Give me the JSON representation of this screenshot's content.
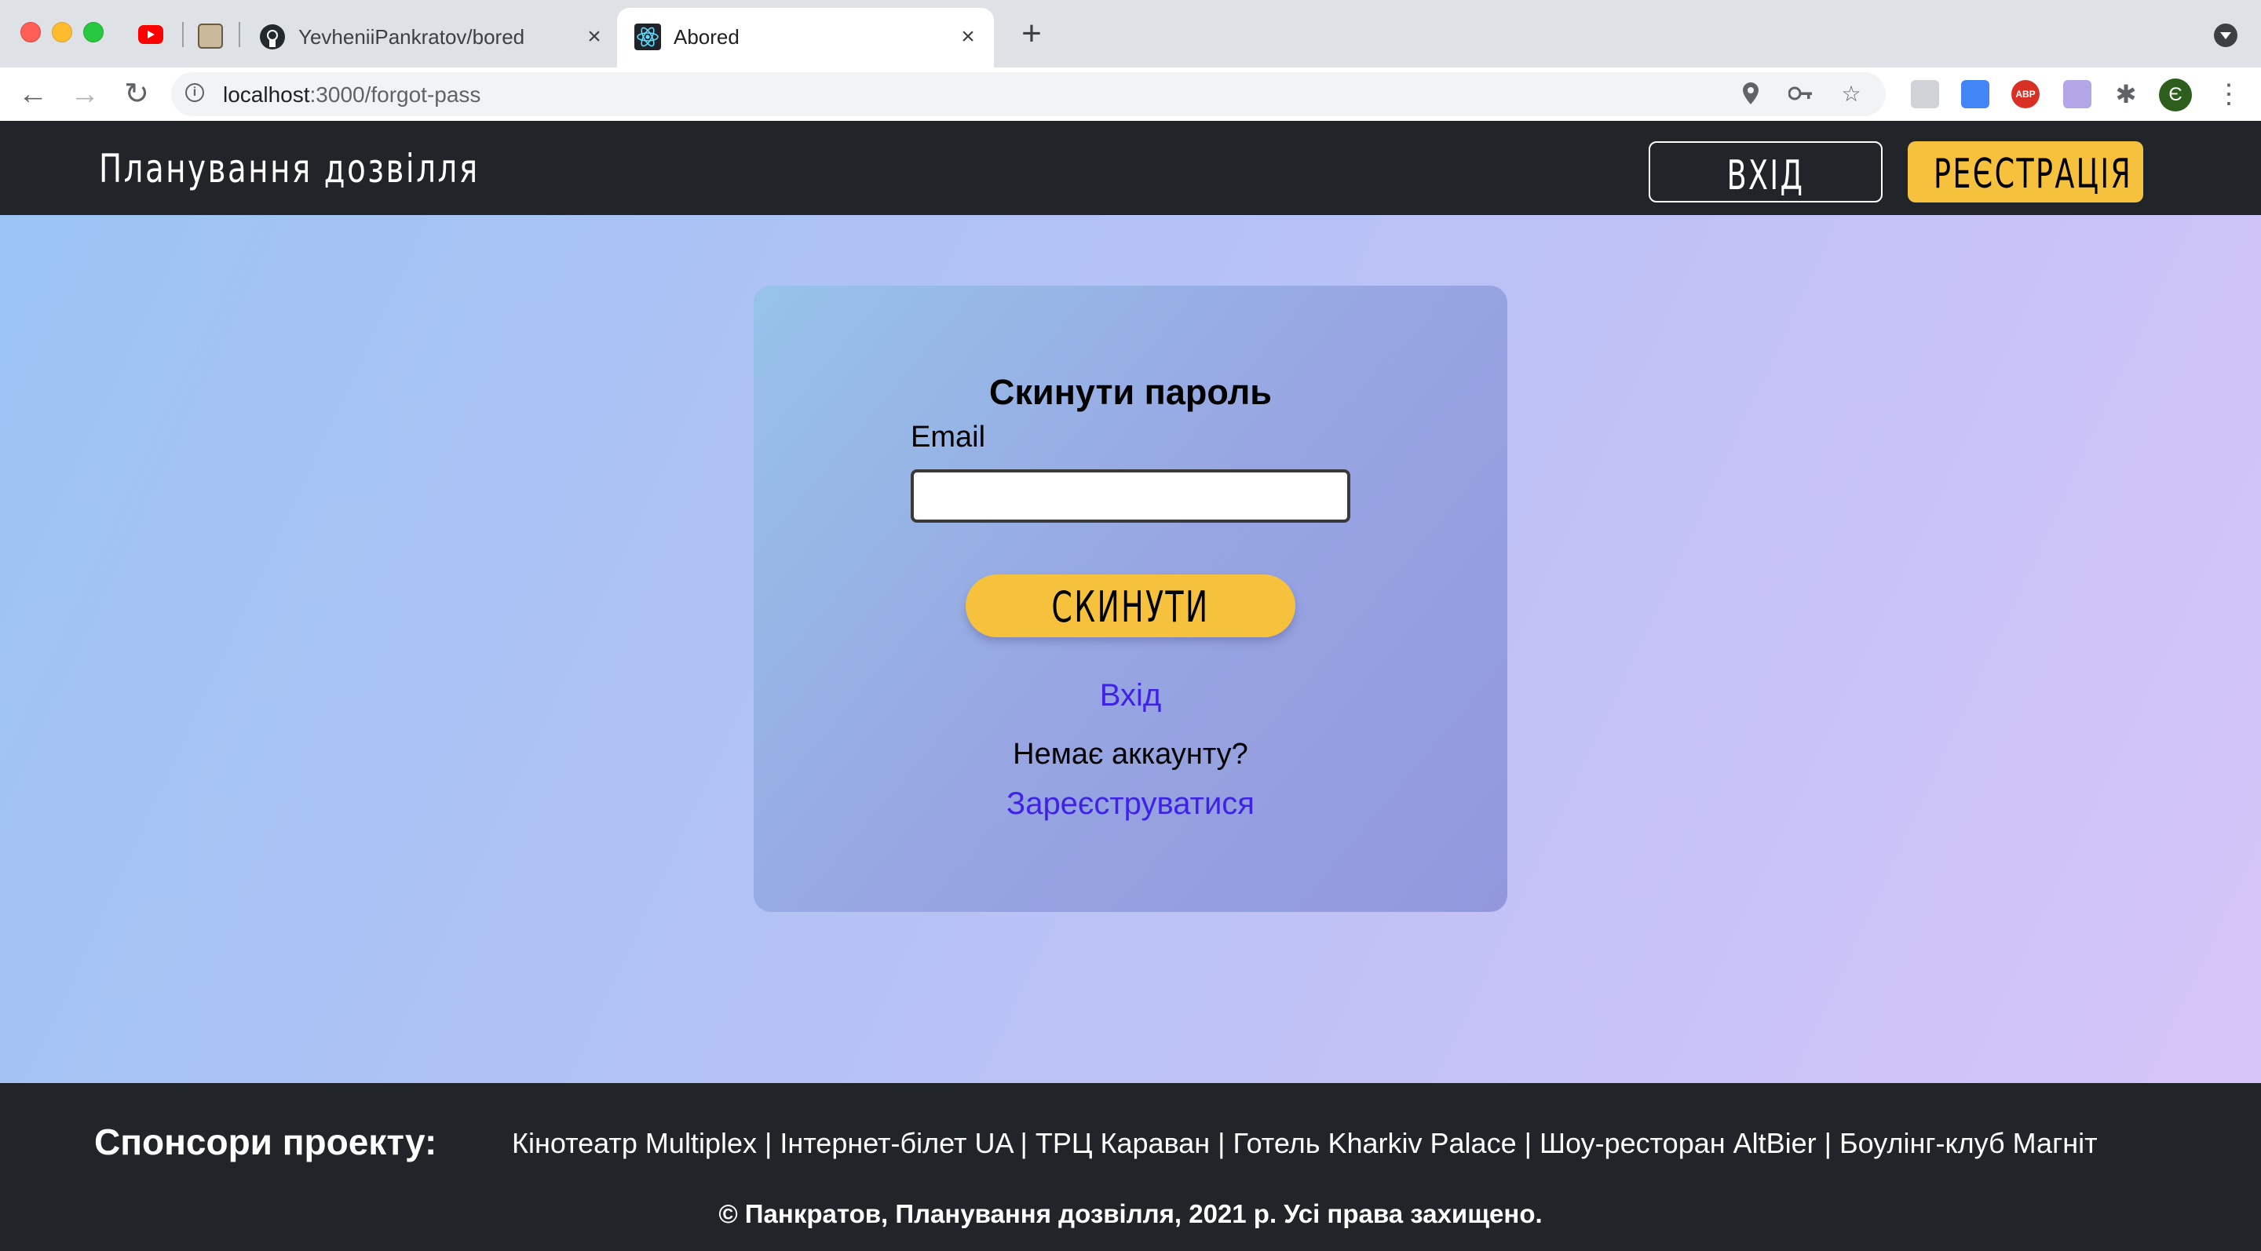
{
  "browser": {
    "tabs": [
      {
        "title": "YevheniiPankratov/bored",
        "icon": "github-icon"
      },
      {
        "title": "Abored",
        "icon": "react-icon",
        "active": true
      }
    ],
    "url_host": "localhost",
    "url_path": ":3000/forgot-pass",
    "profile_initial": "Є",
    "extension_abp_label": "ABP"
  },
  "header": {
    "site_title": "Планування дозвілля",
    "login_label": "ВХІД",
    "register_label": "РЕЄСТРАЦІЯ"
  },
  "form": {
    "title": "Скинути пароль",
    "email_label": "Email",
    "email_value": "",
    "submit_label": "СКИНУТИ",
    "login_link": "Вхід",
    "no_account_text": "Немає аккаунту?",
    "register_link": "Зареєструватися"
  },
  "footer": {
    "sponsors_title": "Спонсори проекту:",
    "sponsors_list": "Кінотеатр Multiplex | Інтернет-білет UA | ТРЦ Караван | Готель Kharkiv Palace | Шоу-ресторан AltBier | Боулінг-клуб Магніт",
    "copyright": "© Панкратов, Планування дозвілля, 2021 р. Усі права захищено."
  },
  "colors": {
    "accent_yellow": "#f6c23e",
    "dark": "#212529",
    "link": "#3f22e8"
  }
}
